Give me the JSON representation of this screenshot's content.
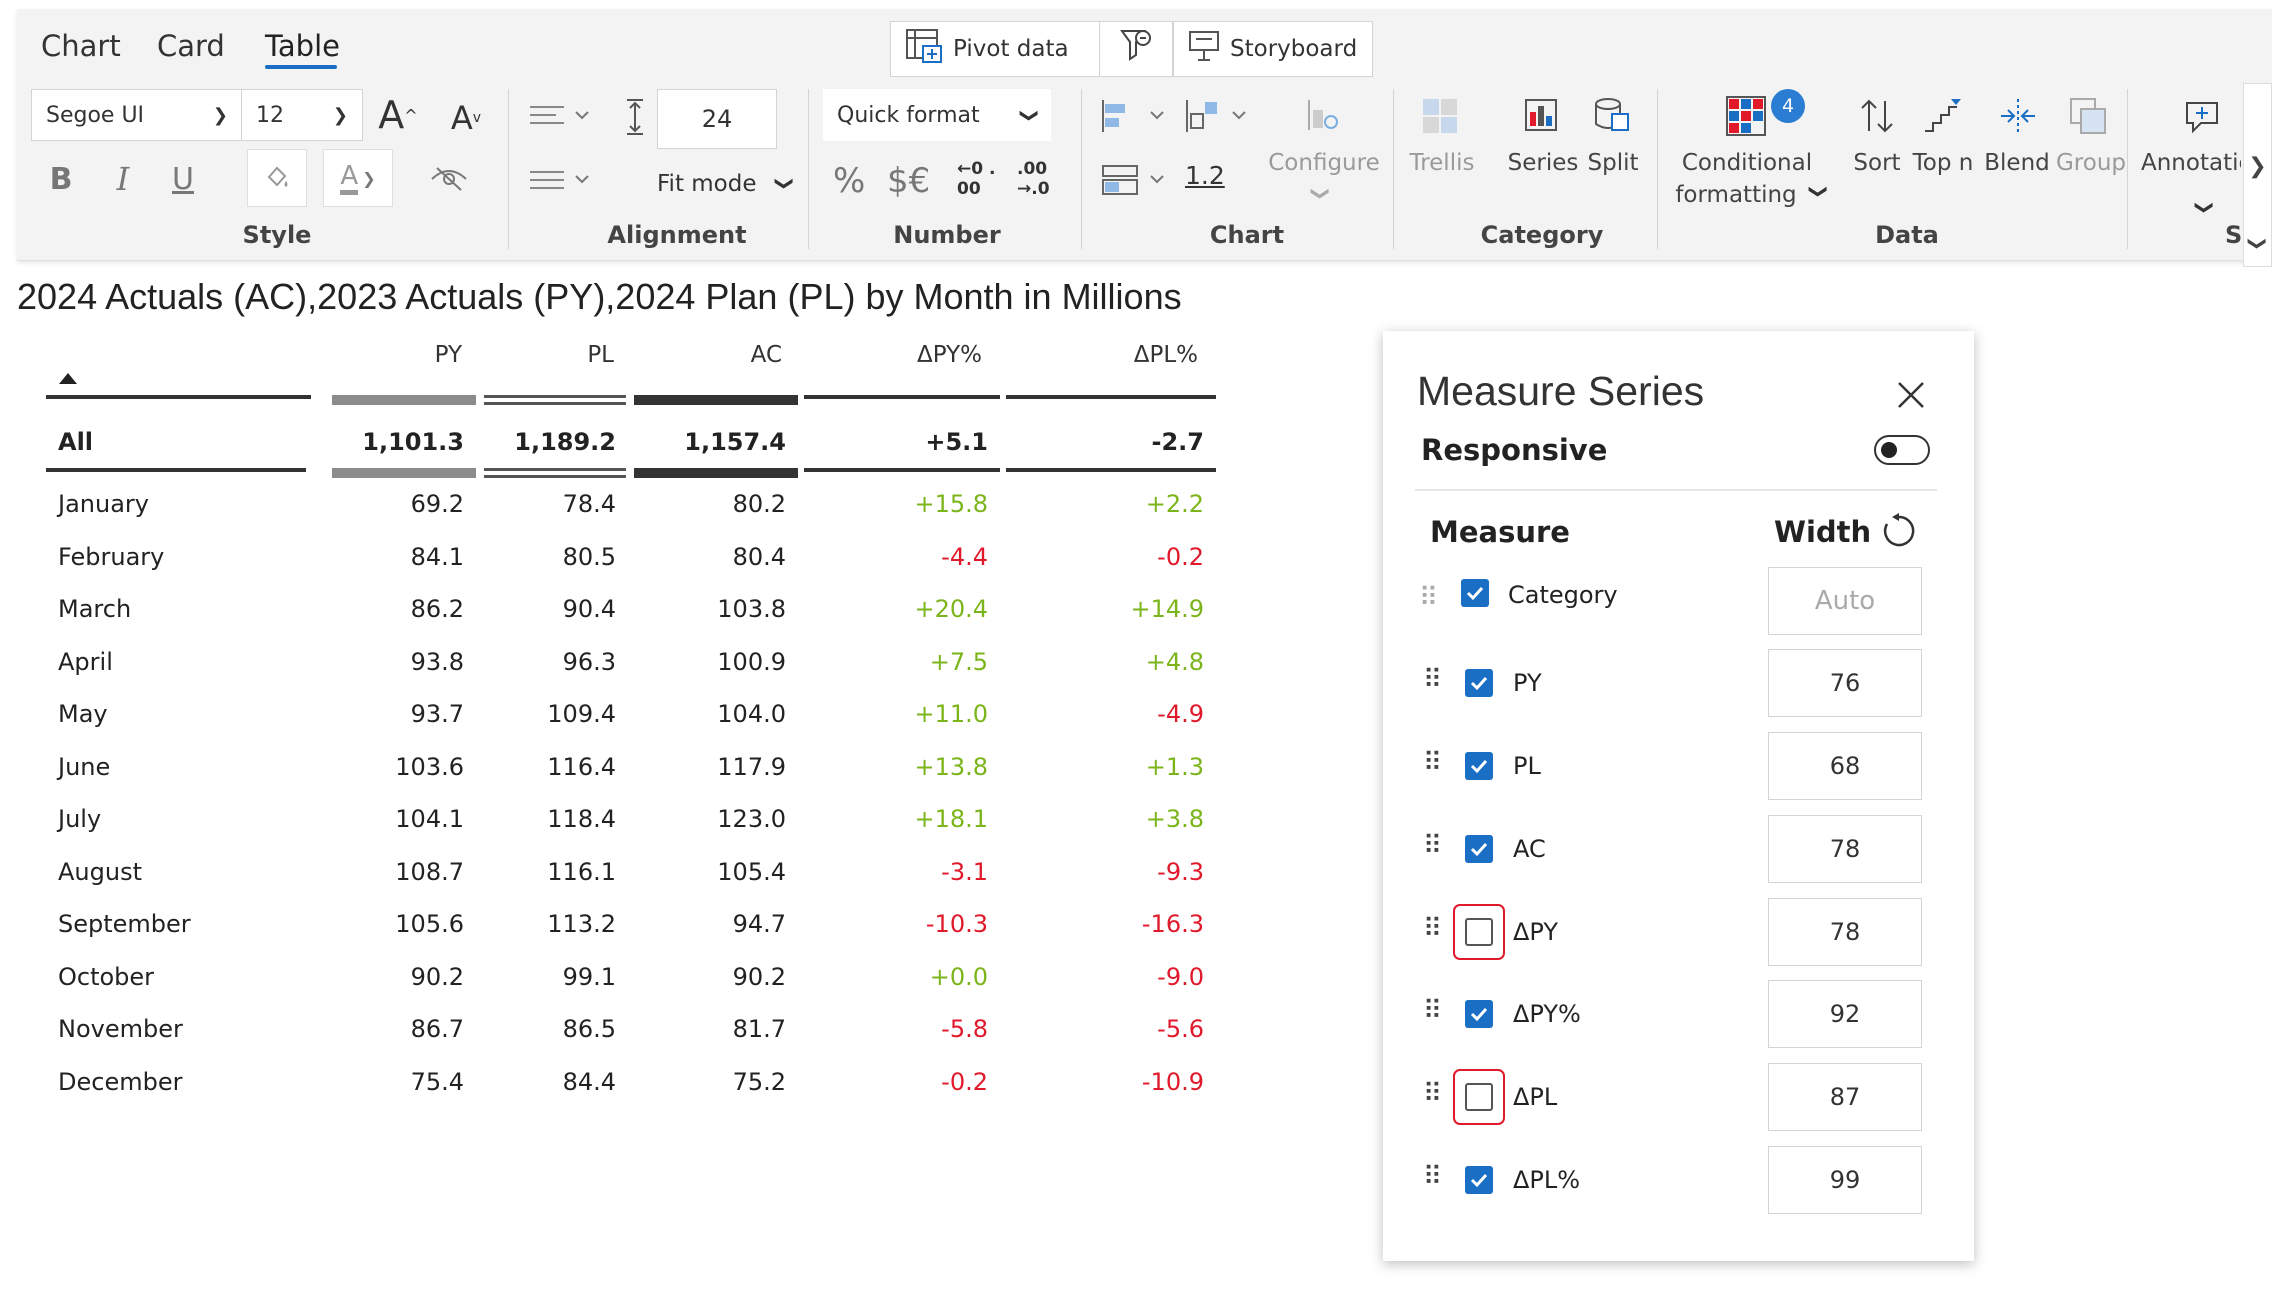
{
  "ribbon": {
    "tabs": [
      {
        "label": "Chart",
        "active": false
      },
      {
        "label": "Card",
        "active": false
      },
      {
        "label": "Table",
        "active": true
      }
    ],
    "top_buttons": {
      "pivot": "Pivot data",
      "storyboard": "Storyboard"
    },
    "style": {
      "font_family": "Segoe UI",
      "font_size": "12",
      "group_label": "Style"
    },
    "alignment": {
      "row_height": "24",
      "fit_mode": "Fit mode",
      "group_label": "Alignment"
    },
    "number": {
      "quick_format": "Quick format",
      "percent": "%",
      "currency": "$€",
      "dec_inc": "←0 .00",
      "dec_dec": ".00 →.0",
      "group_label": "Number"
    },
    "chart": {
      "scale_value": "1.2",
      "configure": "Configure",
      "group_label": "Chart"
    },
    "category": {
      "trellis": "Trellis",
      "series": "Series",
      "split": "Split",
      "group_label": "Category"
    },
    "data": {
      "conditional_formatting_line1": "Conditional",
      "conditional_formatting_line2": "formatting",
      "badge": "4",
      "sort": "Sort",
      "top_n": "Top n",
      "blend": "Blend",
      "group": "Group",
      "group_label": "Data"
    },
    "annotations": {
      "label": "Annotatic",
      "group_label": "S"
    },
    "accent_color": "#1a6fc4"
  },
  "title": "2024 Actuals (AC),2023 Actuals (PY),2024 Plan (PL) by Month in Millions",
  "table": {
    "headers": [
      "PY",
      "PL",
      "AC",
      "ΔPY%",
      "ΔPL%"
    ],
    "total": {
      "label": "All",
      "py": "1,101.3",
      "pl": "1,189.2",
      "ac": "1,157.4",
      "dpy": "+5.1",
      "dpl": "-2.7"
    },
    "rows": [
      {
        "label": "January",
        "py": "69.2",
        "pl": "78.4",
        "ac": "80.2",
        "dpy": "+15.8",
        "dpl": "+2.2"
      },
      {
        "label": "February",
        "py": "84.1",
        "pl": "80.5",
        "ac": "80.4",
        "dpy": "-4.4",
        "dpl": "-0.2"
      },
      {
        "label": "March",
        "py": "86.2",
        "pl": "90.4",
        "ac": "103.8",
        "dpy": "+20.4",
        "dpl": "+14.9"
      },
      {
        "label": "April",
        "py": "93.8",
        "pl": "96.3",
        "ac": "100.9",
        "dpy": "+7.5",
        "dpl": "+4.8"
      },
      {
        "label": "May",
        "py": "93.7",
        "pl": "109.4",
        "ac": "104.0",
        "dpy": "+11.0",
        "dpl": "-4.9"
      },
      {
        "label": "June",
        "py": "103.6",
        "pl": "116.4",
        "ac": "117.9",
        "dpy": "+13.8",
        "dpl": "+1.3"
      },
      {
        "label": "July",
        "py": "104.1",
        "pl": "118.4",
        "ac": "123.0",
        "dpy": "+18.1",
        "dpl": "+3.8"
      },
      {
        "label": "August",
        "py": "108.7",
        "pl": "116.1",
        "ac": "105.4",
        "dpy": "-3.1",
        "dpl": "-9.3"
      },
      {
        "label": "September",
        "py": "105.6",
        "pl": "113.2",
        "ac": "94.7",
        "dpy": "-10.3",
        "dpl": "-16.3"
      },
      {
        "label": "October",
        "py": "90.2",
        "pl": "99.1",
        "ac": "90.2",
        "dpy": "+0.0",
        "dpl": "-9.0"
      },
      {
        "label": "November",
        "py": "86.7",
        "pl": "86.5",
        "ac": "81.7",
        "dpy": "-5.8",
        "dpl": "-5.6"
      },
      {
        "label": "December",
        "py": "75.4",
        "pl": "84.4",
        "ac": "75.2",
        "dpy": "-0.2",
        "dpl": "-10.9"
      }
    ],
    "positive_color": "#7cb51b",
    "negative_color": "#e0192b"
  },
  "panel": {
    "title": "Measure Series",
    "responsive_label": "Responsive",
    "responsive_on": false,
    "measure_header": "Measure",
    "width_header": "Width",
    "measures": [
      {
        "label": "Category",
        "checked": true,
        "width": "Auto"
      },
      {
        "label": "PY",
        "checked": true,
        "width": "76"
      },
      {
        "label": "PL",
        "checked": true,
        "width": "68"
      },
      {
        "label": "AC",
        "checked": true,
        "width": "78"
      },
      {
        "label": "ΔPY",
        "checked": false,
        "width": "78"
      },
      {
        "label": "ΔPY%",
        "checked": true,
        "width": "92"
      },
      {
        "label": "ΔPL",
        "checked": false,
        "width": "87"
      },
      {
        "label": "ΔPL%",
        "checked": true,
        "width": "99"
      }
    ]
  }
}
